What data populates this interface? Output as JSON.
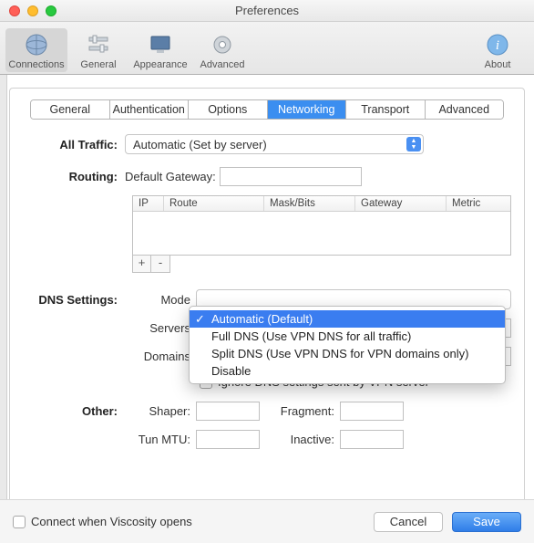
{
  "window": {
    "title": "Preferences"
  },
  "toolbar": {
    "items": [
      {
        "label": "Connections",
        "selected": true
      },
      {
        "label": "General"
      },
      {
        "label": "Appearance"
      },
      {
        "label": "Advanced"
      }
    ],
    "about": "About"
  },
  "tabs": [
    "General",
    "Authentication",
    "Options",
    "Networking",
    "Transport",
    "Advanced"
  ],
  "selected_tab": "Networking",
  "sections": {
    "all_traffic": {
      "label": "All Traffic:",
      "value": "Automatic (Set by server)"
    },
    "routing": {
      "label": "Routing:",
      "gateway_label": "Default Gateway:",
      "gateway_value": "",
      "columns": [
        "IP",
        "Route",
        "Mask/Bits",
        "Gateway",
        "Metric"
      ],
      "add": "+",
      "remove": "-"
    },
    "dns": {
      "label": "DNS Settings:",
      "mode_label": "Mode",
      "servers_label": "Servers",
      "domains_label": "Domains",
      "ignore_label": "Ignore DNS settings sent by VPN server",
      "mode_menu": {
        "items": [
          "Automatic (Default)",
          "Full DNS (Use VPN DNS for all traffic)",
          "Split DNS (Use VPN DNS for VPN domains only)",
          "Disable"
        ],
        "selected_index": 0
      }
    },
    "other": {
      "label": "Other:",
      "shaper_label": "Shaper:",
      "fragment_label": "Fragment:",
      "tunmtu_label": "Tun MTU:",
      "inactive_label": "Inactive:",
      "shaper_value": "",
      "fragment_value": "",
      "tunmtu_value": "",
      "inactive_value": ""
    }
  },
  "bottom": {
    "connect_label": "Connect when Viscosity opens",
    "cancel": "Cancel",
    "save": "Save"
  }
}
